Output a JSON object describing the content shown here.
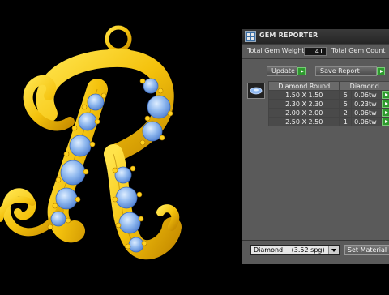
{
  "panel": {
    "title": "GEM REPORTER",
    "total_weight_label": "Total Gem Weight",
    "total_weight_value": ".41",
    "total_count_label": "Total Gem Count",
    "update_label": "Update",
    "save_report_label": "Save Report",
    "table": {
      "headers": [
        "Diamond Round",
        "Diamond"
      ],
      "rows": [
        {
          "size": "1.50 X 1.50",
          "count": "5",
          "weight": "0.06tw"
        },
        {
          "size": "2.30 X 2.30",
          "count": "5",
          "weight": "0.23tw"
        },
        {
          "size": "2.00 X 2.00",
          "count": "2",
          "weight": "0.06tw"
        },
        {
          "size": "2.50 X 2.50",
          "count": "1",
          "weight": "0.06tw"
        }
      ]
    },
    "material_select": "Diamond",
    "material_density": "(3.52 spg)",
    "set_material_label": "Set Material"
  },
  "colors": {
    "gold": "#f4c20d",
    "gem": "#8fb8ef",
    "panel_bg": "#5a5a5a",
    "go_green": "#2e9a2e"
  },
  "icons": {
    "app": "gem-reporter-app-icon",
    "go": "green-arrow-icon",
    "thumb": "round-diamond-icon"
  }
}
